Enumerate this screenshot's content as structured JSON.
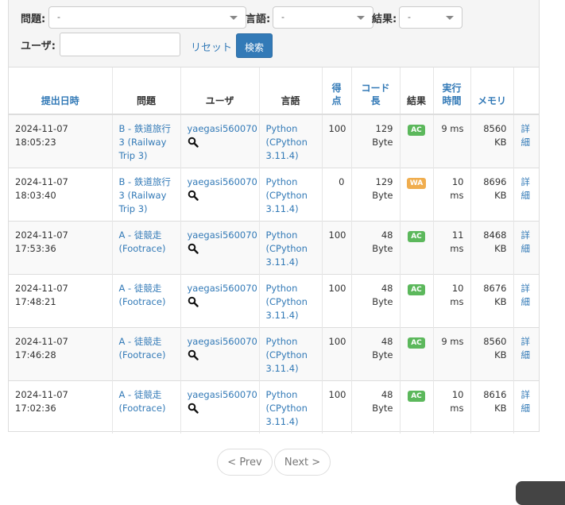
{
  "filter": {
    "problem_label": "問題:",
    "problem_value": "-",
    "language_label": "言語:",
    "language_value": "-",
    "result_label": "結果:",
    "result_value": "-",
    "user_label": "ユーザ:",
    "user_value": "",
    "reset_label": "リセット",
    "search_label": "検索"
  },
  "table": {
    "headers": {
      "submitted": "提出日時",
      "problem": "問題",
      "user": "ユーザ",
      "language": "言語",
      "score": "得点",
      "code_length": "コード長",
      "result": "結果",
      "exec_time": "実行時間",
      "memory": "メモリ"
    },
    "rows": [
      {
        "date": "2024-11-07 18:05:23",
        "problem": "B - 鉄道旅行3 (Railway Trip 3)",
        "user": "yaegasi560070",
        "language": "Python (CPython 3.11.4)",
        "score": "100",
        "code_length": "129 Byte",
        "result": "AC",
        "time": "9 ms",
        "memory": "8560 KB",
        "detail": "詳細"
      },
      {
        "date": "2024-11-07 18:03:40",
        "problem": "B - 鉄道旅行3 (Railway Trip 3)",
        "user": "yaegasi560070",
        "language": "Python (CPython 3.11.4)",
        "score": "0",
        "code_length": "129 Byte",
        "result": "WA",
        "time": "10 ms",
        "memory": "8696 KB",
        "detail": "詳細"
      },
      {
        "date": "2024-11-07 17:53:36",
        "problem": "A - 徒競走 (Footrace)",
        "user": "yaegasi560070",
        "language": "Python (CPython 3.11.4)",
        "score": "100",
        "code_length": "48 Byte",
        "result": "AC",
        "time": "11 ms",
        "memory": "8468 KB",
        "detail": "詳細"
      },
      {
        "date": "2024-11-07 17:48:21",
        "problem": "A - 徒競走 (Footrace)",
        "user": "yaegasi560070",
        "language": "Python (CPython 3.11.4)",
        "score": "100",
        "code_length": "48 Byte",
        "result": "AC",
        "time": "10 ms",
        "memory": "8676 KB",
        "detail": "詳細"
      },
      {
        "date": "2024-11-07 17:46:28",
        "problem": "A - 徒競走 (Footrace)",
        "user": "yaegasi560070",
        "language": "Python (CPython 3.11.4)",
        "score": "100",
        "code_length": "48 Byte",
        "result": "AC",
        "time": "9 ms",
        "memory": "8560 KB",
        "detail": "詳細"
      },
      {
        "date": "2024-11-07 17:02:36",
        "problem": "A - 徒競走 (Footrace)",
        "user": "yaegasi560070",
        "language": "Python (CPython 3.11.4)",
        "score": "100",
        "code_length": "48 Byte",
        "result": "AC",
        "time": "10 ms",
        "memory": "8616 KB",
        "detail": "詳細"
      }
    ]
  },
  "pagination": {
    "prev_label": "< Prev",
    "next_label": "Next >"
  },
  "colors": {
    "accent": "#337ab7",
    "ac": "#5cb85c",
    "wa": "#f0ad4e"
  }
}
